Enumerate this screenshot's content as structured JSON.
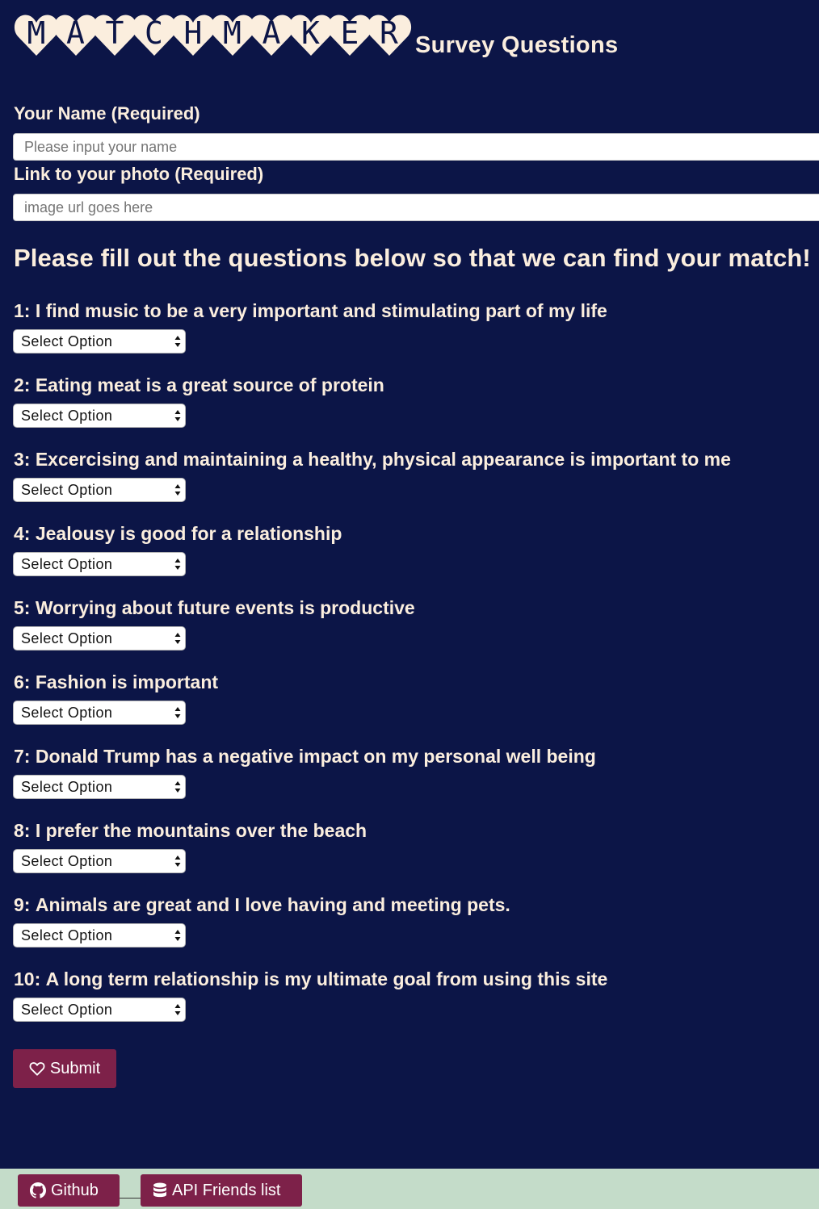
{
  "header": {
    "logo_letters": [
      "M",
      "A",
      "T",
      "C",
      "H",
      "M",
      "A",
      "K",
      "E",
      "R"
    ],
    "subtitle": "Survey Questions"
  },
  "form": {
    "name_label": "Your Name (Required)",
    "name_placeholder": "Please input your name",
    "photo_label": "Link to your photo (Required)",
    "photo_placeholder": "image url goes here"
  },
  "prompt": "Please fill out the questions below so that we can find your match!",
  "questions": [
    {
      "num": "1:",
      "text": "I find music to be a very important and stimulating part of my life",
      "selected": "Select Option"
    },
    {
      "num": "2:",
      "text": "Eating meat is a great source of protein",
      "selected": "Select Option"
    },
    {
      "num": "3:",
      "text": "Excercising and maintaining a healthy, physical appearance is important to me",
      "selected": "Select Option"
    },
    {
      "num": "4:",
      "text": "Jealousy is good for a relationship",
      "selected": "Select Option"
    },
    {
      "num": "5:",
      "text": "Worrying about future events is productive",
      "selected": "Select Option"
    },
    {
      "num": "6:",
      "text": "Fashion is important",
      "selected": "Select Option"
    },
    {
      "num": "7:",
      "text": "Donald Trump has a negative impact on my personal well being",
      "selected": "Select Option"
    },
    {
      "num": "8:",
      "text": "I prefer the mountains over the beach",
      "selected": "Select Option"
    },
    {
      "num": "9:",
      "text": "Animals are great and I love having and meeting pets.",
      "selected": "Select Option"
    },
    {
      "num": "10:",
      "text": "A long term relationship is my ultimate goal from using this site",
      "selected": "Select Option"
    }
  ],
  "submit_label": "Submit",
  "footer": {
    "github_label": "Github",
    "api_label": "API Friends list"
  },
  "colors": {
    "background": "#0c1547",
    "text": "#fbeede",
    "accent": "#7d2149",
    "footer": "#c4dcc9"
  }
}
